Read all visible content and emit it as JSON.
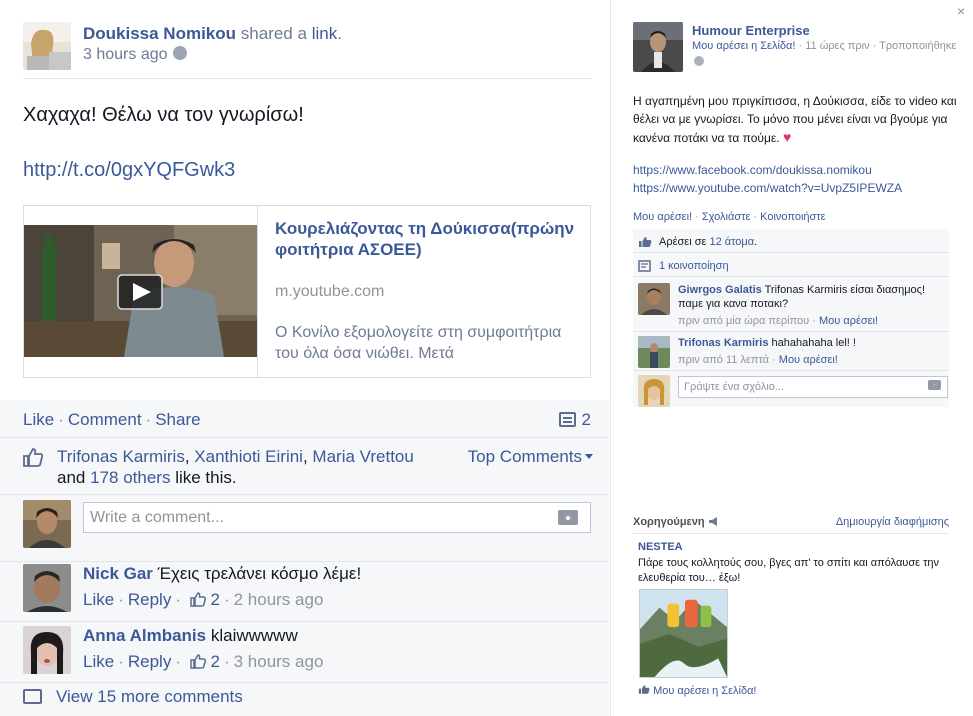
{
  "post": {
    "author": "Doukissa Nomikou",
    "shared_text": "shared a",
    "link_word": "link",
    "period": ".",
    "time": "3 hours ago",
    "text": "Χαχαχα! Θέλω να τον γνωρίσω!",
    "url": "http://t.co/0gxYQFGwk3",
    "link_card": {
      "title": "Κουρελιάζοντας τη Δούκισσα(πρώην φοιτήτρια ΑΣΟΕΕ)",
      "domain": "m.youtube.com",
      "description": "Ο Κονίλο εξομολογείτε στη συμφοιτήτρια του όλα όσα νιώθει. Μετά"
    }
  },
  "ufi": {
    "like": "Like",
    "comment": "Comment",
    "share": "Share",
    "comment_count": "2",
    "likers": [
      "Trifonas Karmiris",
      "Xanthioti Eirini",
      "Maria Vrettou"
    ],
    "and_text": "and",
    "others": "178 others",
    "like_this": "like this.",
    "top_comments": "Top Comments",
    "write_placeholder": "Write a comment...",
    "comments": [
      {
        "name": "Nick Gar",
        "text": "Έχεις τρελάνει κόσμο λέμε!",
        "like": "Like",
        "reply": "Reply",
        "likes": "2",
        "time": "2 hours ago"
      },
      {
        "name": "Anna Almbanis",
        "text": "klaiwwwww",
        "like": "Like",
        "reply": "Reply",
        "likes": "2",
        "time": "3 hours ago"
      }
    ],
    "view_more": "View 15 more comments"
  },
  "right": {
    "close": "×",
    "page_name": "Humour Enterprise",
    "page_like": "Μου αρέσει η Σελίδα!",
    "time": "11 ώρες πριν",
    "edited": "Τροποποιήθηκε",
    "text": "Η αγαπημένη μου πριγκίπισσα, η Δούκισσα, είδε το video και θέλει να με γνωρίσει. Το μόνο που μένει είναι να βγούμε για κανένα ποτάκι να τα πούμε.",
    "url1": "https://www.facebook.com/doukissa.nomikou",
    "url2": "https://www.youtube.com/watch?v=UvpZ5IPEWZA",
    "action_like": "Μου αρέσει!",
    "action_comment": "Σχολιάστε",
    "action_share": "Κοινοποιήστε",
    "likes_prefix": "Αρέσει σε",
    "likes_count": "12 άτομα",
    "shares": "1 κοινοποίηση",
    "comments": [
      {
        "name": "Giwrgos Galatis",
        "text": "Trifonas Karmiris είσαι διασημος! παμε για κανα ποτακι?",
        "time": "πριν από μία ώρα περίπου",
        "like": "Μου αρέσει!"
      },
      {
        "name": "Trifonas Karmiris",
        "text": "hahahahaha lel! !",
        "time": "πριν από 11 λεπτά",
        "like": "Μου αρέσει!"
      }
    ],
    "comment_placeholder": "Γράψτε ένα σχόλιο...",
    "sponsored": "Χορηγούμενη",
    "create_ad": "Δημιουργία διαφήμισης",
    "ad": {
      "name": "NESTEA",
      "text": "Πάρε τους κολλητούς σου, βγες απ' το σπίτι και απόλαυσε την ελευθερία του… έξω!",
      "like": "Μου αρέσει η Σελίδα!"
    }
  },
  "colors": {
    "link": "#3b5998",
    "ufi_bg": "#f6f7f9",
    "heart": "#e0395f"
  }
}
